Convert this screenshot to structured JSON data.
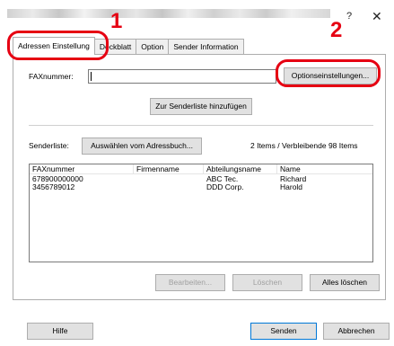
{
  "dialog": {
    "help_glyph": "?",
    "close_glyph": "✕"
  },
  "steps": {
    "one": "1",
    "two": "2"
  },
  "tabs": [
    {
      "label": "Adressen Einstellung",
      "active": true
    },
    {
      "label": "Deckblatt",
      "active": false
    },
    {
      "label": "Option",
      "active": false
    },
    {
      "label": "Sender Information",
      "active": false
    }
  ],
  "fax": {
    "label": "FAXnummer:",
    "value": "",
    "options_button": "Optionseinstellungen..."
  },
  "add_to_senderlist_button": "Zur Senderliste hinzufügen",
  "senderlist": {
    "label": "Senderliste:",
    "addressbook_button": "Auswählen vom Adressbuch...",
    "count_text": "2 Items / Verbleibende   98 Items",
    "columns": [
      "FAXnummer",
      "Firmenname",
      "Abteilungsname",
      "Name"
    ],
    "rows": [
      [
        "678900000000",
        "",
        "ABC Tec.",
        "Richard"
      ],
      [
        "3456789012",
        "",
        "DDD Corp.",
        "Harold"
      ]
    ]
  },
  "list_actions": {
    "edit": "Bearbeiten...",
    "delete": "Löschen",
    "delete_all": "Alles löschen"
  },
  "footer": {
    "help": "Hilfe",
    "send": "Senden",
    "cancel": "Abbrechen"
  },
  "colors": {
    "annotation_red": "#e60012",
    "focus_blue": "#0078d7"
  }
}
